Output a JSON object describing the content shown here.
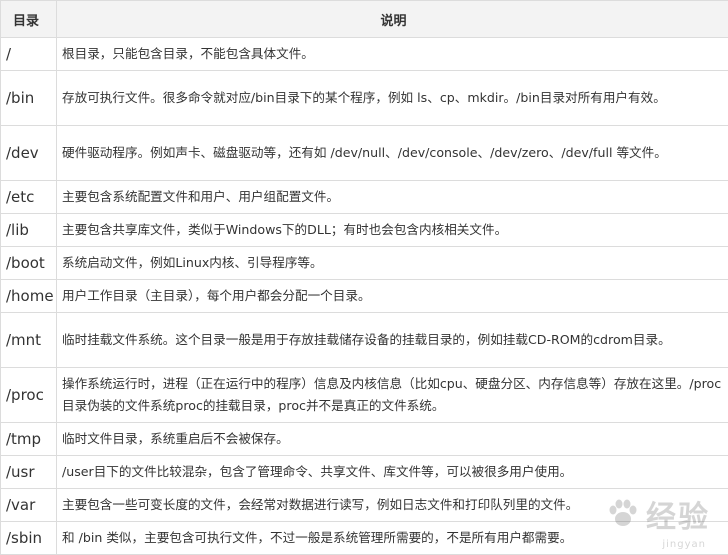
{
  "table": {
    "header_dir": "目录",
    "header_desc": "说明",
    "rows": [
      {
        "dir": "/",
        "desc": "根目录，只能包含目录，不能包含具体文件。"
      },
      {
        "dir": "/bin",
        "desc": "存放可执行文件。很多命令就对应/bin目录下的某个程序，例如 ls、cp、mkdir。/bin目录对所有用户有效。"
      },
      {
        "dir": "/dev",
        "desc": "硬件驱动程序。例如声卡、磁盘驱动等，还有如 /dev/null、/dev/console、/dev/zero、/dev/full 等文件。"
      },
      {
        "dir": "/etc",
        "desc": "主要包含系统配置文件和用户、用户组配置文件。"
      },
      {
        "dir": "/lib",
        "desc": "主要包含共享库文件，类似于Windows下的DLL；有时也会包含内核相关文件。"
      },
      {
        "dir": "/boot",
        "desc": "系统启动文件，例如Linux内核、引导程序等。"
      },
      {
        "dir": "/home",
        "desc": "用户工作目录（主目录），每个用户都会分配一个目录。"
      },
      {
        "dir": "/mnt",
        "desc": "临时挂载文件系统。这个目录一般是用于存放挂载储存设备的挂载目录的，例如挂载CD-ROM的cdrom目录。"
      },
      {
        "dir": "/proc",
        "desc": "操作系统运行时，进程（正在运行中的程序）信息及内核信息（比如cpu、硬盘分区、内存信息等）存放在这里。/proc目录伪装的文件系统proc的挂载目录，proc并不是真正的文件系统。"
      },
      {
        "dir": "/tmp",
        "desc": "临时文件目录，系统重启后不会被保存。"
      },
      {
        "dir": "/usr",
        "desc": "/user目下的文件比较混杂，包含了管理命令、共享文件、库文件等，可以被很多用户使用。"
      },
      {
        "dir": "/var",
        "desc": "主要包含一些可变长度的文件，会经常对数据进行读写，例如日志文件和打印队列里的文件。"
      },
      {
        "dir": "/sbin",
        "desc": "和 /bin 类似，主要包含可执行文件，不过一般是系统管理所需要的，不是所有用户都需要。"
      }
    ]
  },
  "watermark": {
    "text": "经验",
    "sub": "jingyan"
  }
}
